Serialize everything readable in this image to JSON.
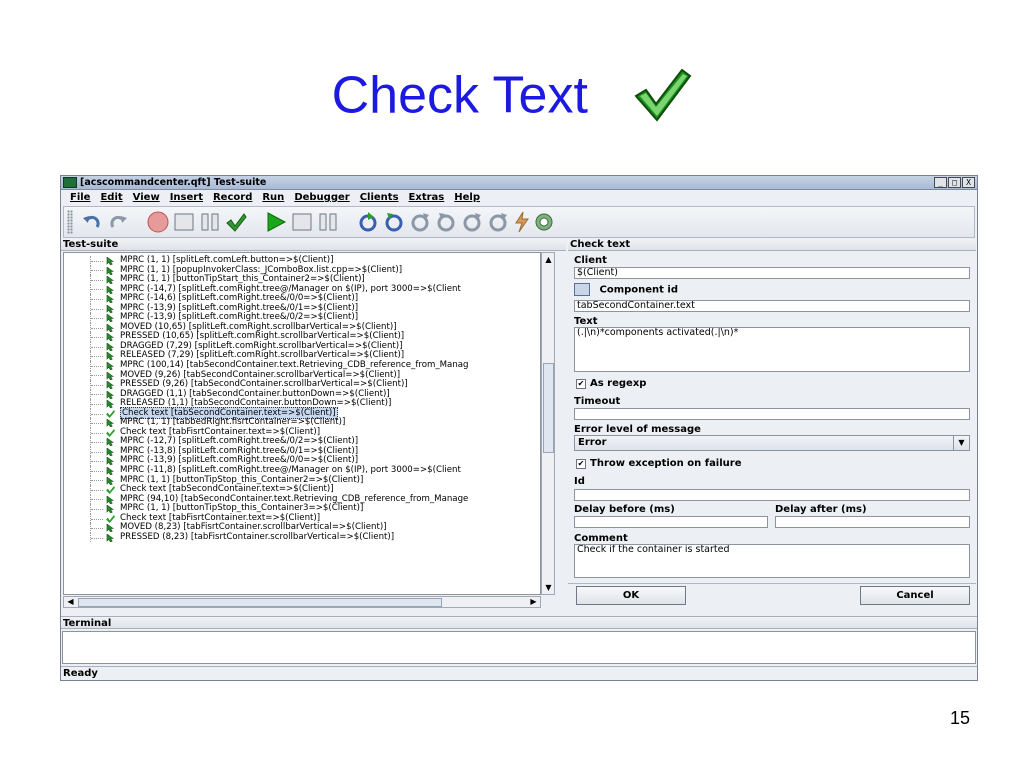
{
  "slide": {
    "title": "Check Text",
    "page_number": "15"
  },
  "window": {
    "title": "[acscommandcenter.qft] Test-suite",
    "buttons": [
      "_",
      "□",
      "X"
    ]
  },
  "menu": [
    "File",
    "Edit",
    "View",
    "Insert",
    "Record",
    "Run",
    "Debugger",
    "Clients",
    "Extras",
    "Help"
  ],
  "toolbar": {
    "icons": [
      "undo-icon",
      "redo-icon",
      "record-icon",
      "stop-record-icon",
      "pause-icon",
      "check-icon",
      "play-icon",
      "stop-icon",
      "pause-run-icon",
      "step-into-icon",
      "step-over-icon",
      "step-out-icon",
      "skip-icon",
      "refresh-icon",
      "continue-icon",
      "flash-icon",
      "eye-icon"
    ]
  },
  "left_pane": {
    "header": "Test-suite",
    "nodes": [
      {
        "text": "MPRC (1, 1) [splitLeft.comLeft.button=>$(Client)]",
        "type": "mouse"
      },
      {
        "text": "MPRC (1, 1) [popupInvokerClass:_JComboBox.list.cpp=>$(Client)]",
        "type": "mouse"
      },
      {
        "text": "MPRC (1, 1) [buttonTipStart_this_Container2=>$(Client)]",
        "type": "mouse"
      },
      {
        "text": "MPRC (-14,7) [splitLeft.comRight.tree@/Manager on $(IP), port 3000=>$(Client",
        "type": "mouse"
      },
      {
        "text": "MPRC (-14,6) [splitLeft.comRight.tree&/0/0=>$(Client)]",
        "type": "mouse"
      },
      {
        "text": "MPRC (-13,9) [splitLeft.comRight.tree&/0/1=>$(Client)]",
        "type": "mouse"
      },
      {
        "text": "MPRC (-13,9) [splitLeft.comRight.tree&/0/2=>$(Client)]",
        "type": "mouse"
      },
      {
        "text": "MOVED (10,65) [splitLeft.comRight.scrollbarVertical=>$(Client)]",
        "type": "mouse"
      },
      {
        "text": "PRESSED (10,65) [splitLeft.comRight.scrollbarVertical=>$(Client)]",
        "type": "mouse"
      },
      {
        "text": "DRAGGED (7,29) [splitLeft.comRight.scrollbarVertical=>$(Client)]",
        "type": "mouse"
      },
      {
        "text": "RELEASED (7,29) [splitLeft.comRight.scrollbarVertical=>$(Client)]",
        "type": "mouse"
      },
      {
        "text": "MPRC (100,14) [tabSecondContainer.text.Retrieving_CDB_reference_from_Manag",
        "type": "mouse"
      },
      {
        "text": "MOVED (9,26) [tabSecondContainer.scrollbarVertical=>$(Client)]",
        "type": "mouse"
      },
      {
        "text": "PRESSED (9,26) [tabSecondContainer.scrollbarVertical=>$(Client)]",
        "type": "mouse"
      },
      {
        "text": "DRAGGED (1,1) [tabSecondContainer.buttonDown=>$(Client)]",
        "type": "mouse"
      },
      {
        "text": "RELEASED (1,1) [tabSecondContainer.buttonDown=>$(Client)]",
        "type": "mouse"
      },
      {
        "text": "Check text [tabSecondContainer.text=>$(Client)]",
        "type": "check",
        "selected": true
      },
      {
        "text": "MPRC (1, 1) [tabbedRight.fisrtContainer=>$(Client)]",
        "type": "mouse"
      },
      {
        "text": "Check text [tabFisrtContainer.text=>$(Client)]",
        "type": "check"
      },
      {
        "text": "MPRC (-12,7) [splitLeft.comRight.tree&/0/2=>$(Client)]",
        "type": "mouse"
      },
      {
        "text": "MPRC (-13,8) [splitLeft.comRight.tree&/0/1=>$(Client)]",
        "type": "mouse"
      },
      {
        "text": "MPRC (-13,9) [splitLeft.comRight.tree&/0/0=>$(Client)]",
        "type": "mouse"
      },
      {
        "text": "MPRC (-11,8) [splitLeft.comRight.tree@/Manager on $(IP), port 3000=>$(Client",
        "type": "mouse"
      },
      {
        "text": "MPRC (1, 1) [buttonTipStop_this_Container2=>$(Client)]",
        "type": "mouse"
      },
      {
        "text": "Check text [tabSecondContainer.text=>$(Client)]",
        "type": "check"
      },
      {
        "text": "MPRC (94,10) [tabSecondContainer.text.Retrieving_CDB_reference_from_Manage",
        "type": "mouse"
      },
      {
        "text": "MPRC (1, 1) [buttonTipStop_this_Container3=>$(Client)]",
        "type": "mouse"
      },
      {
        "text": "Check text [tabFisrtContainer.text=>$(Client)]",
        "type": "check"
      },
      {
        "text": "MOVED (8,23) [tabFisrtContainer.scrollbarVertical=>$(Client)]",
        "type": "mouse"
      },
      {
        "text": "PRESSED (8,23) [tabFisrtContainer.scrollbarVertical=>$(Client)]",
        "type": "mouse"
      }
    ]
  },
  "right_pane": {
    "header": "Check text",
    "client_label": "Client",
    "client_value": "$(Client)",
    "component_id_label": "Component id",
    "component_id_value": "tabSecondContainer.text",
    "text_label": "Text",
    "text_value": "(.|\\n)*components activated(.|\\n)*",
    "as_regexp_label": "As regexp",
    "as_regexp_checked": true,
    "timeout_label": "Timeout",
    "timeout_value": "",
    "error_level_label": "Error level of message",
    "error_level_value": "Error",
    "throw_exception_label": "Throw exception on failure",
    "throw_exception_checked": true,
    "id_label": "Id",
    "id_value": "",
    "delay_before_label": "Delay before (ms)",
    "delay_before_value": "",
    "delay_after_label": "Delay after (ms)",
    "delay_after_value": "",
    "comment_label": "Comment",
    "comment_value": "Check if the container is started",
    "ok_label": "OK",
    "cancel_label": "Cancel"
  },
  "terminal": {
    "header": "Terminal",
    "content": ""
  },
  "status": "Ready",
  "colors": {
    "title_blue": "#1c1ae0",
    "check_green": "#2aa02a"
  }
}
